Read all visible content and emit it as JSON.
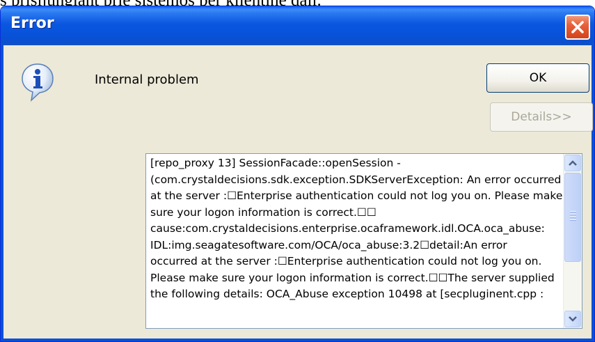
{
  "background": {
    "text": "s prisijungiant prie sistemos per klientinę dalį."
  },
  "dialog": {
    "title": "Error",
    "message": "Internal problem",
    "ok_label": "OK",
    "details_label": "Details>>",
    "details_lines": [
      "[repo_proxy 13] SessionFacade::openSession -",
      "(com.crystaldecisions.sdk.exception.SDKServerException: An error occurred",
      "at the server :☐Enterprise authentication could not log you on. Please make",
      "sure your logon information is correct.☐☐",
      "cause:com.crystaldecisions.enterprise.ocaframework.idl.OCA.oca_abuse:",
      "IDL:img.seagatesoftware.com/OCA/oca_abuse:3.2☐detail:An error",
      "occurred at the server :☐Enterprise authentication could not log you on.",
      "Please make sure your logon information is correct.☐☐The server supplied",
      "the following details: OCA_Abuse exception 10498 at [secpluginent.cpp :"
    ],
    "icons": {
      "message": "info-icon",
      "close": "close-icon",
      "scroll_up": "chevron-up-icon",
      "scroll_down": "chevron-down-icon"
    }
  },
  "colors": {
    "titlebar": "#0a57e0",
    "close_button": "#e8603a",
    "window_face": "#ece9d8",
    "details_border": "#7f9db9"
  }
}
